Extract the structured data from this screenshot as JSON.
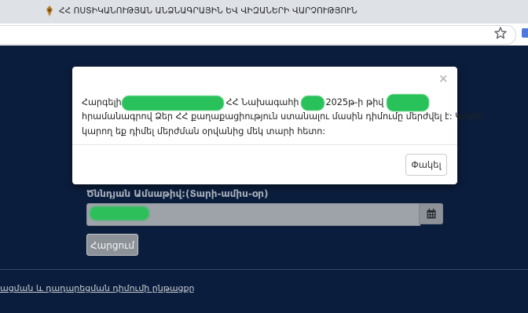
{
  "browser": {
    "tab_title": "ՀՀ ՈՍՏԻԿԱՆՈՒԹՅԱՆ ԱՆՁՆԱԳՐԱՅԻՆ ԵՎ ՎԻԶԱՆԵՐԻ ՎԱՐՉՈՒԹՅՈՒՆ",
    "address": ""
  },
  "form": {
    "dob_label": "Ծննդյան Ամսաթիվ:(Տարի-ամիս-օր)",
    "submit_label": "Հարցում"
  },
  "footer": {
    "link_text": "ացման և դադարեցման դիմումի ընթացքը"
  },
  "modal": {
    "close_x": "×",
    "line1_a": "Հարգելի",
    "line1_b": "ՀՀ Նախագահի",
    "line1_c": "2025թ-ի թիվ",
    "line2": "հրամանագրով Ձեր ՀՀ քաղաքացիություն ստանալու մասին դիմումը մերժվել է: Կրկին",
    "line3": "կարող եք դիմել մերժման օրվանից մեկ տարի հետո:",
    "close_button": "Փակել"
  },
  "colors": {
    "page_bg": "#0b1d3c",
    "redaction": "#29c15a"
  }
}
